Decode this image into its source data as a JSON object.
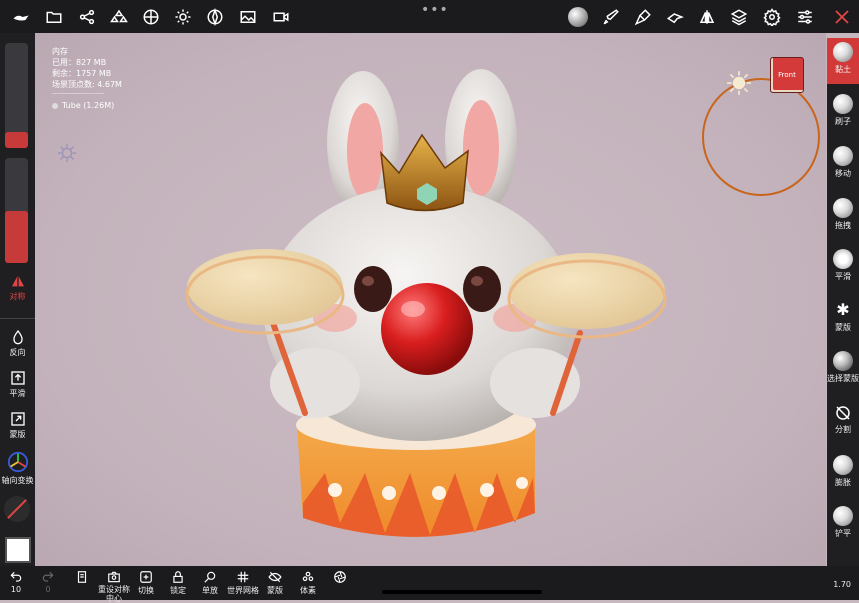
{
  "topbar": {
    "icons": [
      "app-logo-icon",
      "folder-icon",
      "share-icon",
      "scene-icon",
      "grid-icon",
      "sun-icon",
      "material-icon",
      "image-icon",
      "video-icon",
      "sphere-icon",
      "brush-icon",
      "paint-icon",
      "wing-icon",
      "symmetry-icon",
      "layers-icon",
      "settings-icon",
      "sliders-icon",
      "tools-icon"
    ]
  },
  "info": {
    "title": "内存",
    "used": "已用：827 MB",
    "free": "剩余：1757 MB",
    "vertices": "场景顶点数: 4.67M",
    "divider": "------------------------",
    "mesh": "Tube (1.26M)"
  },
  "left": {
    "symmetry": "对称",
    "invert": "反向",
    "smooth": "平滑",
    "mask": "蒙版",
    "axis_transform": "轴向变换",
    "radius_value": 0.1,
    "intensity_value": 0.5
  },
  "right": {
    "tools": [
      "黏土",
      "刷子",
      "移动",
      "拖拽",
      "平滑",
      "蒙版",
      "选择蒙版",
      "分割",
      "膨胀",
      "铲平"
    ]
  },
  "bottom": {
    "undo_count": "10",
    "redo_count": "0",
    "items": [
      "重设对称中心",
      "切换",
      "锁定",
      "单放",
      "世界网格",
      "蒙版",
      "体素"
    ],
    "zoom": "1.70"
  },
  "gizmo": {
    "face": "Front"
  },
  "colors": {
    "accent": "#d23a3a",
    "ring": "#c8651c"
  }
}
